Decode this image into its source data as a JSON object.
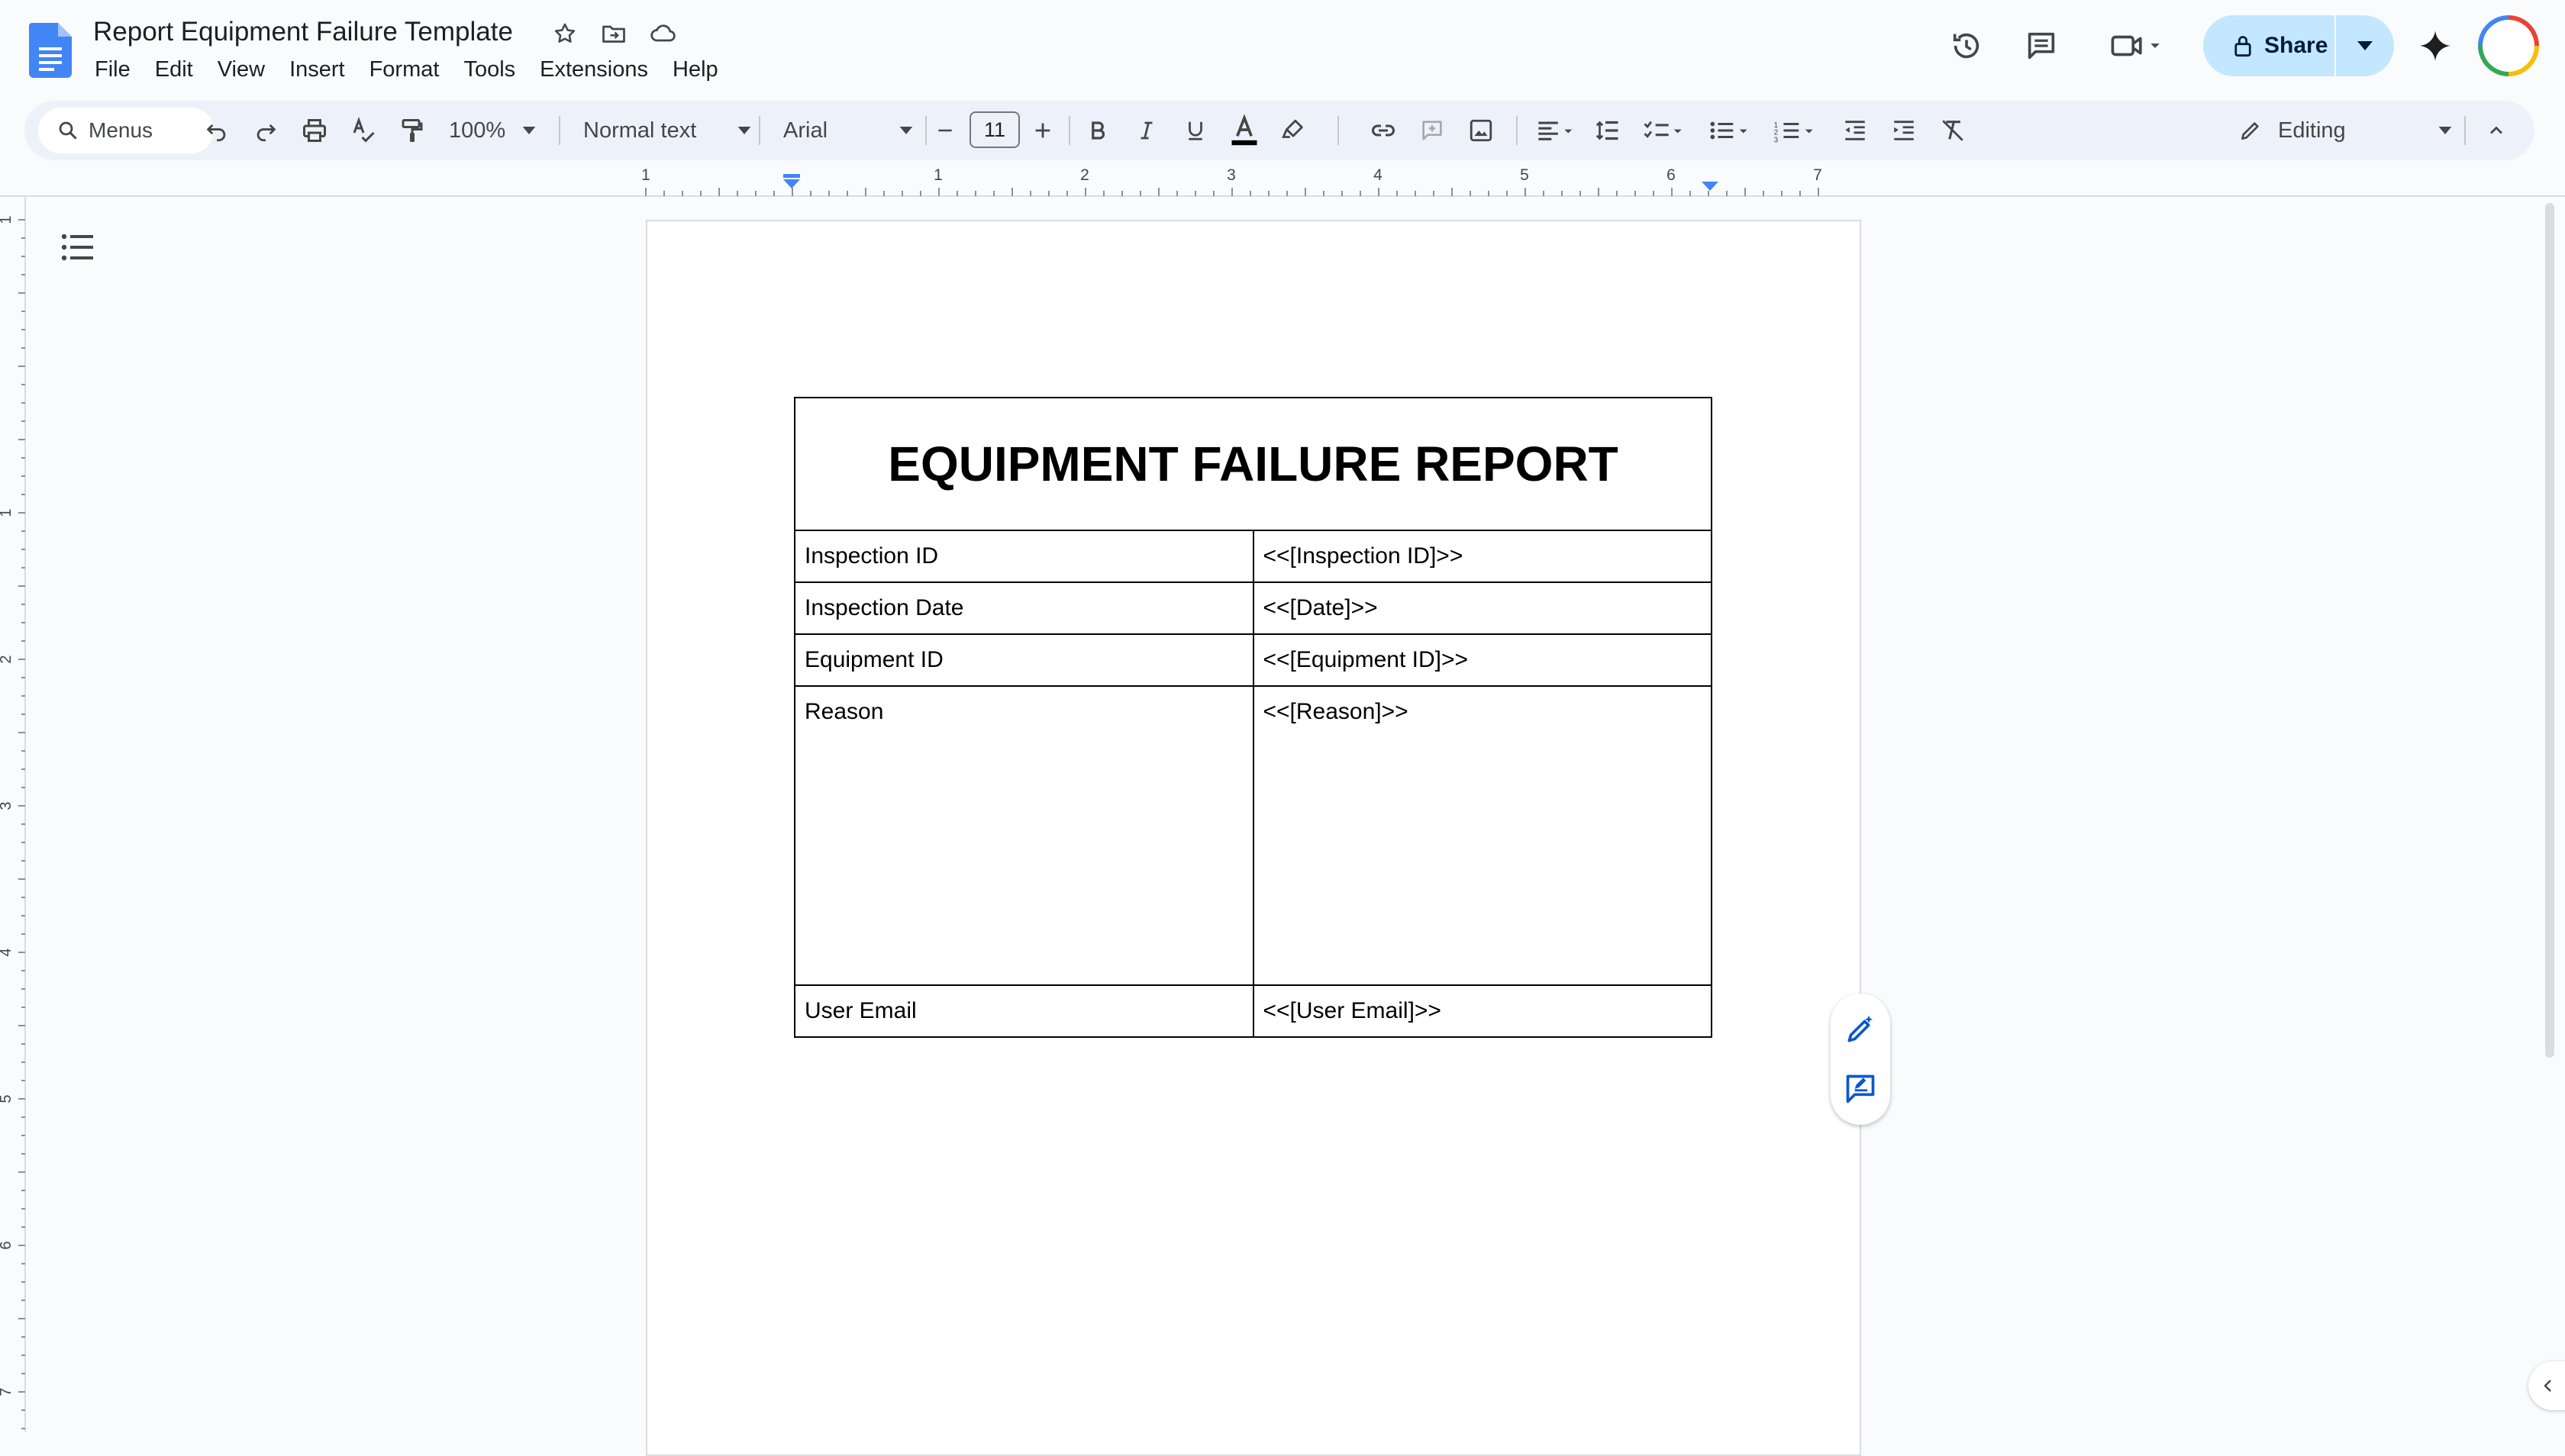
{
  "document": {
    "title": "Report Equipment Failure Template"
  },
  "menu": {
    "items": [
      {
        "label": "File"
      },
      {
        "label": "Edit"
      },
      {
        "label": "View"
      },
      {
        "label": "Insert"
      },
      {
        "label": "Format"
      },
      {
        "label": "Tools"
      },
      {
        "label": "Extensions"
      },
      {
        "label": "Help"
      }
    ]
  },
  "header": {
    "share_label": "Share"
  },
  "toolbar": {
    "search_label": "Menus",
    "zoom": "100%",
    "paragraph_style": "Normal text",
    "font_family": "Arial",
    "font_size": "11",
    "editing_mode": "Editing"
  },
  "ruler": {
    "labels": [
      "1",
      "1",
      "2",
      "3",
      "4",
      "5",
      "6",
      "7"
    ],
    "vertical_labels": [
      "1",
      "1",
      "2",
      "3",
      "4",
      "5",
      "6",
      "7"
    ]
  },
  "report": {
    "title": "EQUIPMENT FAILURE REPORT",
    "rows": [
      {
        "label": "Inspection ID",
        "value": "<<[Inspection ID]>>"
      },
      {
        "label": "Inspection Date",
        "value": "<<[Date]>>"
      },
      {
        "label": "Equipment ID",
        "value": "<<[Equipment ID]>>"
      },
      {
        "label": "Reason",
        "value": "<<[Reason]>>"
      },
      {
        "label": "User Email",
        "value": "<<[User Email]>>"
      }
    ]
  },
  "colors": {
    "share_background": "#c2e7ff",
    "toolbar_background": "#edf2fa",
    "docs_blue": "#4285f4",
    "text_color_underline": "#000000"
  }
}
